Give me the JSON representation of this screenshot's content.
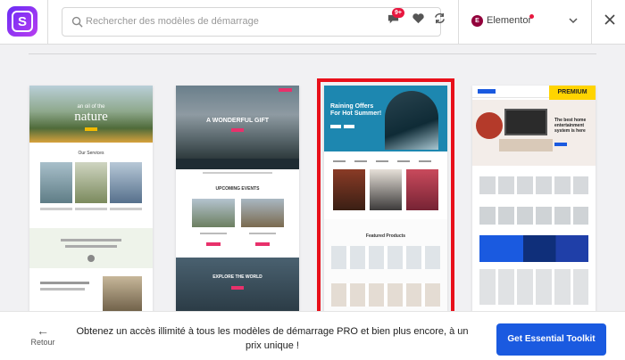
{
  "header": {
    "search_placeholder": "Rechercher des modèles de démarrage",
    "notification_badge": "9+",
    "builder_name": "Elementor"
  },
  "templates": [
    {
      "hero_title_small": "an oil of the",
      "hero_title": "nature",
      "section_title": "Our Services"
    },
    {
      "hero_title": "A WONDERFUL GIFT",
      "section_title": "UPCOMING EVENTS",
      "footer_title": "EXPLORE THE WORLD"
    },
    {
      "hero_title": "Raining Offers For Hot Summer!",
      "section_title": "Featured Products",
      "selected": true
    },
    {
      "badge": "PREMIUM",
      "hero_title": "The best home entertainment system is here"
    }
  ],
  "footer": {
    "back_label": "Retour",
    "promo_text": "Obtenez un accès illimité à tous les modèles de démarrage PRO et bien plus encore, à un prix unique !",
    "cta_label": "Get Essential Toolkit"
  },
  "colors": {
    "accent": "#1a5ae0",
    "selection": "#e8101a",
    "badge": "#e8173f",
    "logo_gradient": [
      "#6a2cf5",
      "#b83df0"
    ]
  }
}
